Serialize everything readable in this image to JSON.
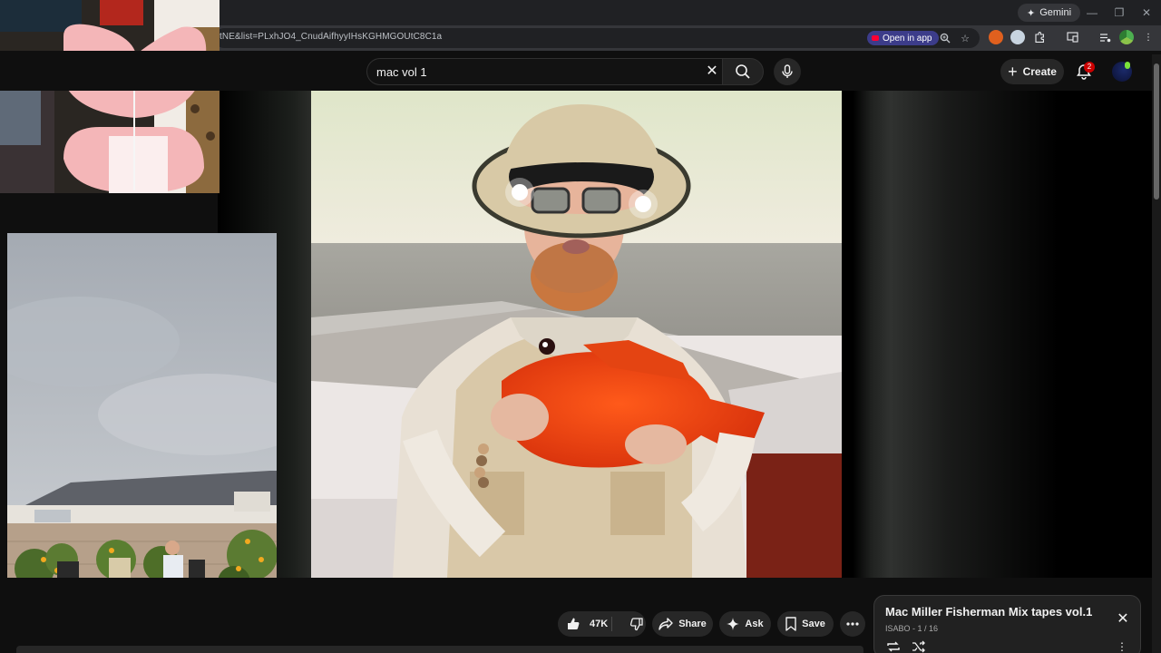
{
  "browser": {
    "gemini_label": "Gemini",
    "url": "tNE&list=PLxhJO4_CnudAifhyyIHsKGHMGOUtC8C1a",
    "open_in_app": "Open in app"
  },
  "youtube": {
    "search_value": "mac vol 1",
    "create_label": "Create",
    "notification_count": "2"
  },
  "actions": {
    "like_count": "47K",
    "share_label": "Share",
    "ask_label": "Ask",
    "save_label": "Save"
  },
  "playlist": {
    "title": "Mac Miller Fisherman Mix tapes vol.1",
    "meta": "ISABO - 1 / 16"
  },
  "icons": {
    "gemini": "sparkle-icon",
    "zoom": "zoom-icon",
    "bookmark": "star-icon",
    "extensions": "puzzle-icon",
    "cast": "cast-icon",
    "media": "media-queue-icon",
    "profile": "profile-icon",
    "menu": "kebab-menu-icon",
    "clear": "close-icon",
    "search": "search-icon",
    "mic": "mic-icon",
    "bell": "bell-icon",
    "like": "thumbs-up-icon",
    "dislike": "thumbs-down-icon",
    "share": "share-icon",
    "ask": "sparkle-icon",
    "save": "bookmark-icon",
    "more": "more-icon",
    "loop": "loop-icon",
    "shuffle": "shuffle-icon"
  },
  "colors": {
    "background": "#0f0f0f",
    "pill": "#272727",
    "badge": "#cc0000",
    "open_in_app": "#3c3c8a"
  }
}
